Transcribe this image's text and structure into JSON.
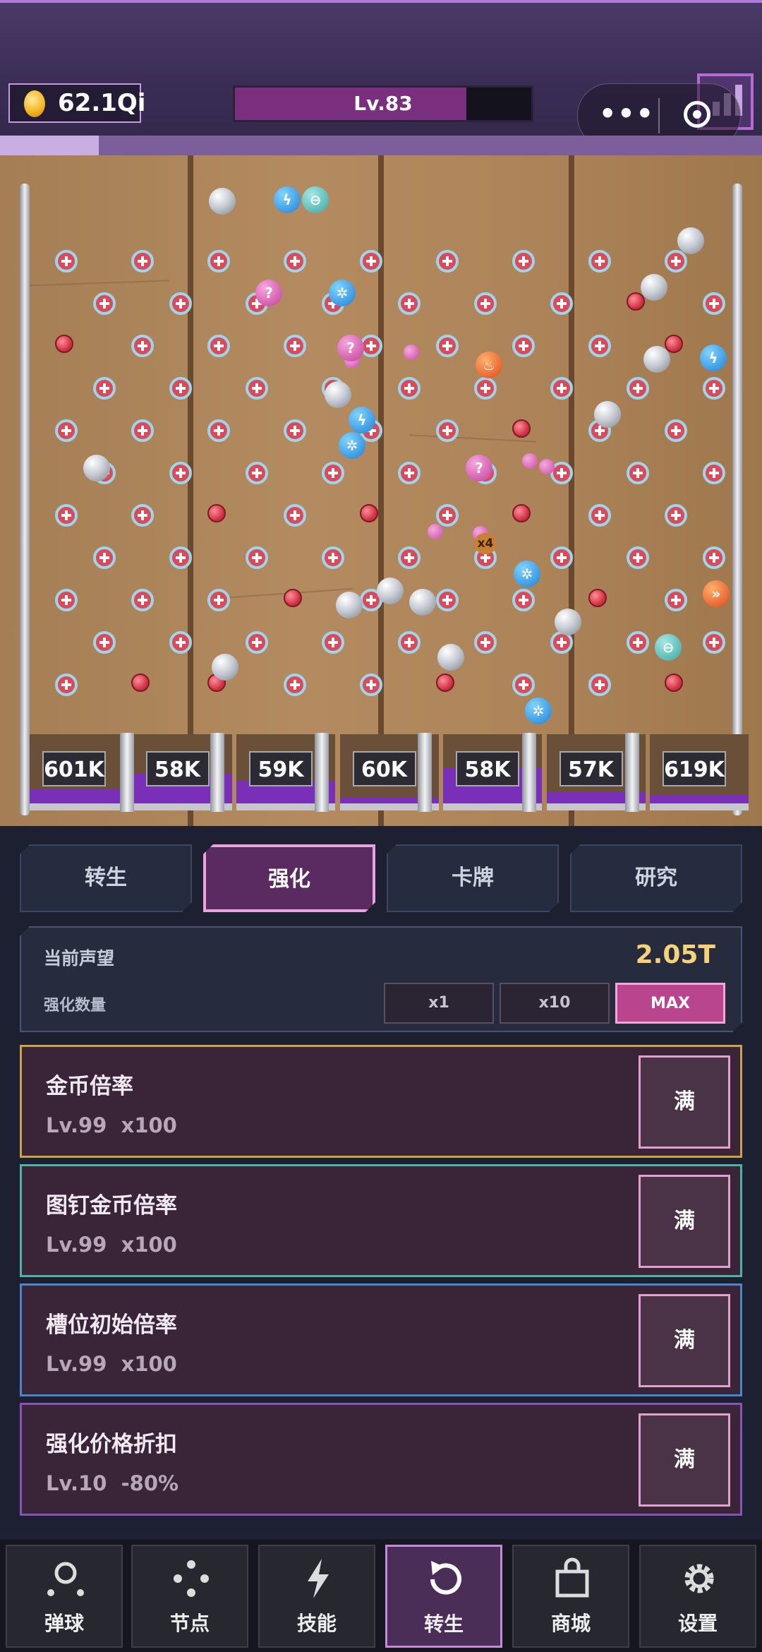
{
  "header": {
    "coins": "62.1Qi",
    "level": "Lv.83",
    "level_progress": 0.78,
    "wave_progress": 0.13
  },
  "board": {
    "slots": [
      "601K",
      "58K",
      "59K",
      "60K",
      "58K",
      "57K",
      "619K"
    ],
    "multiplier_badge": "x4"
  },
  "tabs": [
    {
      "label": "转生",
      "active": false
    },
    {
      "label": "强化",
      "active": true
    },
    {
      "label": "卡牌",
      "active": false
    },
    {
      "label": "研究",
      "active": false
    }
  ],
  "reputation": {
    "label": "当前声望",
    "value": "2.05T",
    "quantity_label": "强化数量",
    "options": [
      "x1",
      "x10",
      "MAX"
    ],
    "selected": "MAX"
  },
  "upgrades": [
    {
      "name": "金币倍率",
      "level": "Lv.99",
      "effect": "x100",
      "button": "满",
      "border": "#c9a24a"
    },
    {
      "name": "图钉金币倍率",
      "level": "Lv.99",
      "effect": "x100",
      "button": "满",
      "border": "#4fb3a3"
    },
    {
      "name": "槽位初始倍率",
      "level": "Lv.99",
      "effect": "x100",
      "button": "满",
      "border": "#4a86c9"
    },
    {
      "name": "强化价格折扣",
      "level": "Lv.10",
      "effect": "-80%",
      "button": "满",
      "border": "#8a52b8"
    }
  ],
  "nav": [
    {
      "label": "弹球",
      "icon": "ball-icon"
    },
    {
      "label": "节点",
      "icon": "nodes-icon"
    },
    {
      "label": "技能",
      "icon": "lightning-icon"
    },
    {
      "label": "转生",
      "icon": "rebirth-icon",
      "active": true
    },
    {
      "label": "商城",
      "icon": "shop-bag-icon"
    },
    {
      "label": "设置",
      "icon": "gear-icon"
    }
  ]
}
